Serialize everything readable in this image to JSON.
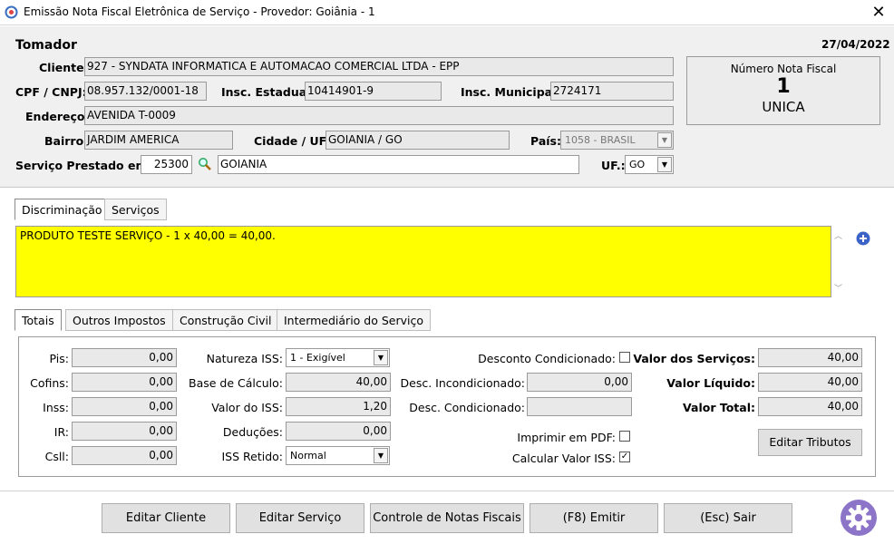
{
  "window": {
    "title": "Emissão Nota Fiscal Eletrônica de Serviço - Provedor: Goiânia - 1"
  },
  "tomador": {
    "heading": "Tomador",
    "date": "27/04/2022",
    "cliente_label": "Cliente:",
    "cliente_value": "927 - SYNDATA INFORMATICA E AUTOMACAO COMERCIAL LTDA - EPP",
    "cpf_label": "CPF / CNPJ:",
    "cpf_value": "08.957.132/0001-18",
    "insc_estadual_label": "Insc. Estadual:",
    "insc_estadual_value": "10414901-9",
    "insc_municipal_label": "Insc. Municipal:",
    "insc_municipal_value": "2724171",
    "endereco_label": "Endereço:",
    "endereco_value": "AVENIDA T-0009",
    "bairro_label": "Bairro:",
    "bairro_value": "JARDIM AMERICA",
    "cidade_label": "Cidade / UF:",
    "cidade_value": "GOIANIA / GO",
    "pais_label": "País:",
    "pais_value": "1058 - BRASIL",
    "servico_label": "Serviço Prestado em:",
    "servico_code": "25300",
    "servico_city": "GOIANIA",
    "uf_label": "UF.:",
    "uf_value": "GO"
  },
  "nota": {
    "label": "Número Nota Fiscal",
    "number": "1",
    "series": "UNICA"
  },
  "desc_tabs": [
    {
      "label": "Discriminação"
    },
    {
      "label": "Serviços"
    }
  ],
  "discriminacao": "PRODUTO TESTE SERVIÇO - 1 x 40,00 = 40,00.",
  "tot_tabs": [
    {
      "label": "Totais"
    },
    {
      "label": "Outros Impostos"
    },
    {
      "label": "Construção Civil"
    },
    {
      "label": "Intermediário do Serviço"
    }
  ],
  "totais": {
    "pis_label": "Pis:",
    "pis": "0,00",
    "cofins_label": "Cofins:",
    "cofins": "0,00",
    "inss_label": "Inss:",
    "inss": "0,00",
    "ir_label": "IR:",
    "ir": "0,00",
    "csll_label": "Csll:",
    "csll": "0,00",
    "natureza_label": "Natureza ISS:",
    "natureza": "1 - Exigível",
    "base_label": "Base de Cálculo:",
    "base": "40,00",
    "valor_iss_label": "Valor do ISS:",
    "valor_iss": "1,20",
    "deducoes_label": "Deduções:",
    "deducoes": "0,00",
    "iss_retido_label": "ISS Retido:",
    "iss_retido": "Normal",
    "desc_cond_chk_label": "Desconto Condicionado:",
    "desc_incond_label": "Desc. Incondicionado:",
    "desc_incond": "0,00",
    "desc_cond_label": "Desc. Condicionado:",
    "desc_cond": "",
    "imprimir_label": "Imprimir em PDF:",
    "calcular_label": "Calcular Valor ISS:",
    "calcular_checked": "✓",
    "valor_servicos_label": "Valor dos Serviços:",
    "valor_servicos": "40,00",
    "valor_liquido_label": "Valor Líquido:",
    "valor_liquido": "40,00",
    "valor_total_label": "Valor Total:",
    "valor_total": "40,00",
    "editar_tributos": "Editar Tributos"
  },
  "buttons": {
    "editar_cliente": "Editar Cliente",
    "editar_servico": "Editar Serviço",
    "controle": "Controle de Notas Fiscais",
    "emitir": "(F8) Emitir",
    "sair": "(Esc) Sair"
  },
  "colors": {
    "yellow": "#ffff00",
    "accent": "#3c64c8",
    "gear": "#8c74c8"
  }
}
